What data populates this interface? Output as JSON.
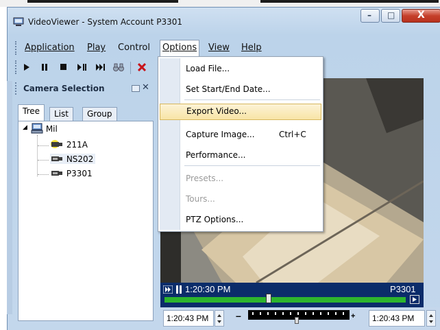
{
  "window": {
    "title": "VideoViewer - System Account P3301",
    "controls": {
      "minimize": "–",
      "maximize": "□",
      "close": "X"
    }
  },
  "menubar": {
    "items": [
      {
        "label": "Application",
        "mnemonic": "A"
      },
      {
        "label": "Play",
        "mnemonic": "P"
      },
      {
        "label": "Control",
        "mnemonic": "r"
      },
      {
        "label": "Options",
        "mnemonic": "O",
        "active": true
      },
      {
        "label": "View",
        "mnemonic": "V"
      },
      {
        "label": "Help",
        "mnemonic": "H"
      }
    ]
  },
  "toolbar": {
    "buttons": [
      "play-icon",
      "pause-icon",
      "stop-icon",
      "step-play-icon",
      "skip-forward-icon",
      "binoculars-icon",
      "delete-icon"
    ]
  },
  "camera_panel": {
    "title": "Camera Selection",
    "close_glyph": "✕",
    "tabs": [
      "Tree",
      "List",
      "Group"
    ],
    "selected_tab": "Tree",
    "tree": {
      "root": {
        "label": "Mil",
        "icon": "computer-icon"
      },
      "children": [
        {
          "label": "211A",
          "icon": "camera-alert-icon"
        },
        {
          "label": "NS202",
          "icon": "camera-icon",
          "selected": true
        },
        {
          "label": "P3301",
          "icon": "camera-icon"
        }
      ]
    }
  },
  "options_menu": {
    "items": [
      {
        "label": "Load File...",
        "shortcut": "",
        "enabled": true
      },
      {
        "label": "Set Start/End Date...",
        "shortcut": "",
        "enabled": true
      },
      {
        "label": "Export Video...",
        "shortcut": "",
        "enabled": true,
        "highlighted": true
      },
      {
        "label": "Capture Image...",
        "shortcut": "Ctrl+C",
        "enabled": true
      },
      {
        "label": "Performance...",
        "shortcut": "",
        "enabled": true
      },
      {
        "label": "Presets...",
        "shortcut": "",
        "enabled": false
      },
      {
        "label": "Tours...",
        "shortcut": "",
        "enabled": false
      },
      {
        "label": "PTZ Options...",
        "shortcut": "",
        "enabled": true
      }
    ]
  },
  "video": {
    "timestamp": "1:20:30 PM",
    "camera_label": "P3301",
    "progress_fraction": 0.42
  },
  "timebar": {
    "start_time": "1:20:43 PM",
    "end_time": "1:20:43 PM",
    "zoom_out": "–",
    "zoom_in": "+"
  },
  "colors": {
    "window_chrome": "#c3d7ec",
    "video_bar": "#0b2c6a",
    "progress": "#2db52d",
    "menu_highlight": "#f8e4a6",
    "close_button": "#c5402b"
  }
}
